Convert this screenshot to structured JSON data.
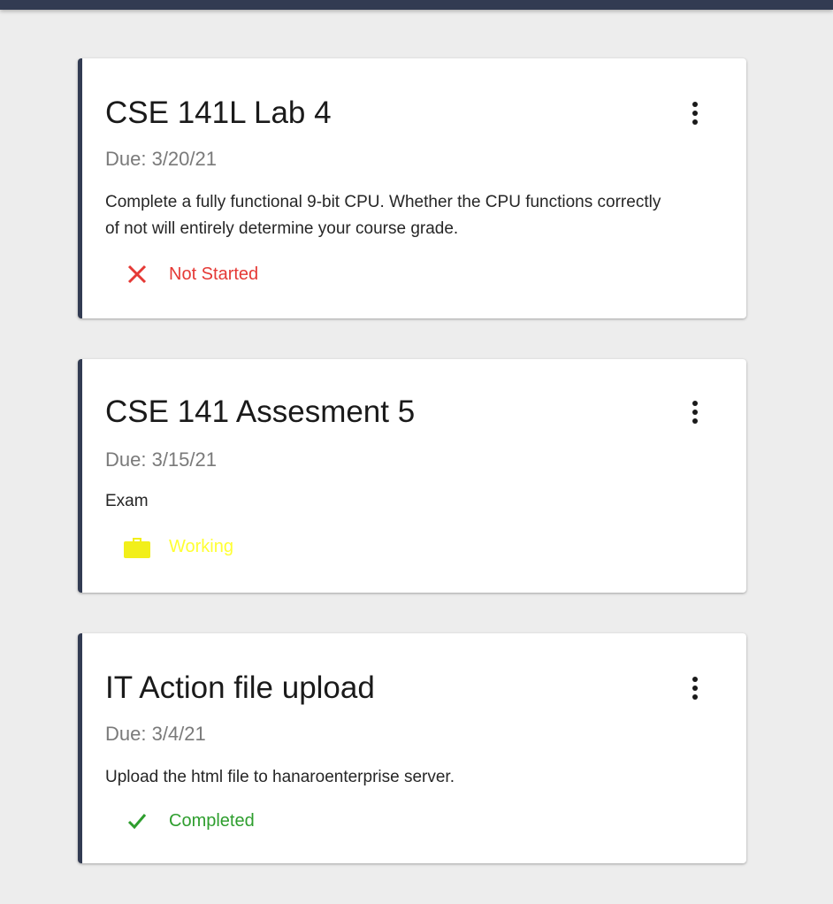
{
  "cards": [
    {
      "title": "CSE 141L Lab 4",
      "due": "Due: 3/20/21",
      "description": "Complete a fully functional 9-bit CPU. Whether the CPU functions correctly of not will entirely determine your course grade.",
      "status": {
        "label": "Not Started",
        "icon": "close-icon",
        "color": "#e53935"
      }
    },
    {
      "title": "CSE 141 Assesment 5",
      "due": "Due: 3/15/21",
      "description": "Exam",
      "status": {
        "label": "Working",
        "icon": "briefcase-icon",
        "color": "#ffff33"
      }
    },
    {
      "title": "IT Action file upload",
      "due": "Due: 3/4/21",
      "description": "Upload the html file to hanaroenterprise server.",
      "status": {
        "label": "Completed",
        "icon": "check-icon",
        "color": "#2e9e2e"
      }
    }
  ],
  "colors": {
    "accent": "#323b52",
    "background": "#ededed"
  }
}
